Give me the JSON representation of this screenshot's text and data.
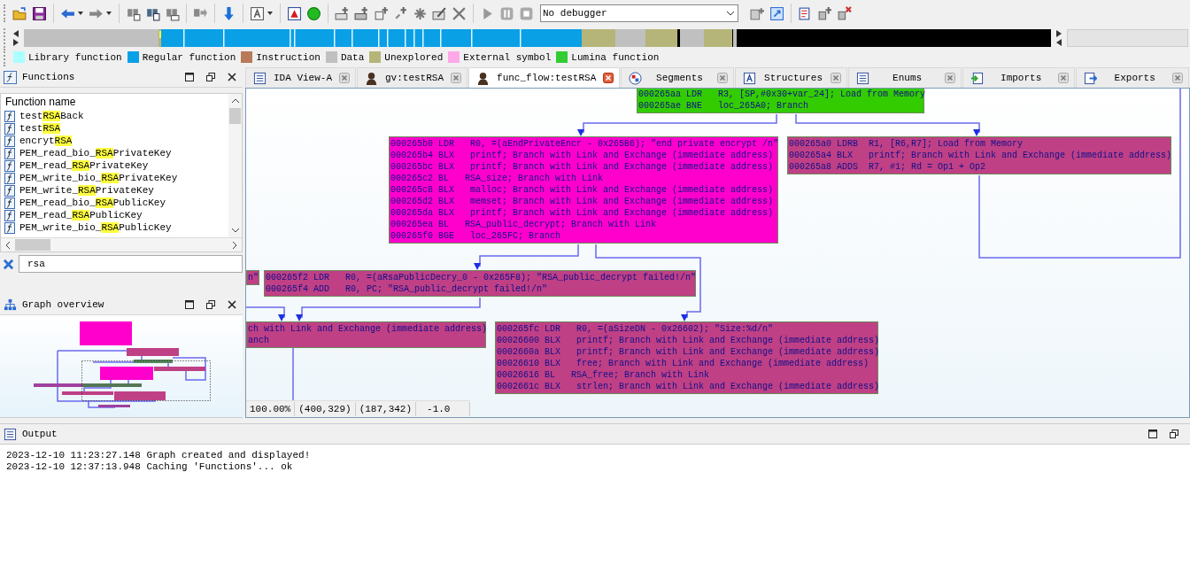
{
  "toolbar": {
    "debugger_select": "No debugger"
  },
  "legend": [
    {
      "label": "Library function",
      "color": "#aaffff"
    },
    {
      "label": "Regular function",
      "color": "#0aa0e6"
    },
    {
      "label": "Instruction",
      "color": "#b87a58"
    },
    {
      "label": "Data",
      "color": "#c0c0c0"
    },
    {
      "label": "Unexplored",
      "color": "#b5b57a"
    },
    {
      "label": "External symbol",
      "color": "#ffa8e8"
    },
    {
      "label": "Lumina function",
      "color": "#33cc33"
    }
  ],
  "functions_panel": {
    "title": "Functions",
    "column": "Function name",
    "items": [
      {
        "prefix": "test",
        "match": "RSA",
        "suffix": "Back"
      },
      {
        "prefix": "test",
        "match": "RSA"
      },
      {
        "prefix": "encryt",
        "match": "RSA"
      },
      {
        "prefix": "PEM_read_bio_",
        "match": "RSA",
        "suffix": "PrivateKey"
      },
      {
        "prefix": "PEM_read_",
        "match": "RSA",
        "suffix": "PrivateKey"
      },
      {
        "prefix": "PEM_write_bio_",
        "match": "RSA",
        "suffix": "PrivateKey"
      },
      {
        "prefix": "PEM_write_",
        "match": "RSA",
        "suffix": "PrivateKey"
      },
      {
        "prefix": "PEM_read_bio_",
        "match": "RSA",
        "suffix": "PublicKey"
      },
      {
        "prefix": "PEM_read_",
        "match": "RSA",
        "suffix": "PublicKey"
      },
      {
        "prefix": "PEM_write_bio_",
        "match": "RSA",
        "suffix": "PublicKey"
      }
    ],
    "filter": "rsa"
  },
  "overview_panel": {
    "title": "Graph overview"
  },
  "tabs": [
    {
      "label": "IDA View-A",
      "selected": false
    },
    {
      "label": "gv:testRSA",
      "selected": false
    },
    {
      "label": "func_flow:testRSA",
      "selected": true
    },
    {
      "label": "Segments",
      "selected": false
    },
    {
      "label": "Structures",
      "selected": false
    },
    {
      "label": "Enums",
      "selected": false
    },
    {
      "label": "Imports",
      "selected": false
    },
    {
      "label": "Exports",
      "selected": false
    }
  ],
  "graph": {
    "blocks": [
      {
        "color": "#33cc00",
        "lines": [
          "000265aa LDR   R3, [SP,#0x30+var_24]; Load from Memory",
          "000265ae BNE   loc_265A0; Branch"
        ]
      },
      {
        "color": "#ff00cc",
        "lines": [
          "000265b0 LDR   R0, =(aEndPrivateEncr - 0x265B6); \"end private encrypt /n\"",
          "000265b4 BLX   printf; Branch with Link and Exchange (immediate address)",
          "000265bc BLX   printf; Branch with Link and Exchange (immediate address)",
          "000265c2 BL   RSA_size; Branch with Link",
          "000265c8 BLX   malloc; Branch with Link and Exchange (immediate address)",
          "000265d2 BLX   memset; Branch with Link and Exchange (immediate address)",
          "000265da BLX   printf; Branch with Link and Exchange (immediate address)",
          "000265ea BL   RSA_public_decrypt; Branch with Link",
          "000265f0 BGE   loc_265FC; Branch"
        ]
      },
      {
        "color": "#bf4085",
        "lines": [
          "000265a0 LDRB  R1, [R6,R7]; Load from Memory",
          "000265a4 BLX   printf; Branch with Link and Exchange (immediate address)",
          "000265a8 ADDS  R7, #1; Rd = Op1 + Op2"
        ]
      },
      {
        "color": "#bf4085",
        "lines": [
          "n\""
        ]
      },
      {
        "color": "#bf4085",
        "lines": [
          "000265f2 LDR   R0, =(aRsaPublicDecry_0 - 0x265F8); \"RSA_public_decrypt failed!/n\"",
          "000265f4 ADD   R0, PC; \"RSA_public_decrypt failed!/n\""
        ]
      },
      {
        "color": "#bf4085",
        "lines": [
          "ch with Link and Exchange (immediate address)",
          "anch"
        ]
      },
      {
        "color": "#bf4085",
        "lines": [
          "000265fc LDR   R0, =(aSizeDN - 0x26602); \"Size:%d/n\"",
          "00026600 BLX   printf; Branch with Link and Exchange (immediate address)",
          "0002660a BLX   printf; Branch with Link and Exchange (immediate address)",
          "00026610 BLX   free; Branch with Link and Exchange (immediate address)",
          "00026616 BL   RSA_free; Branch with Link",
          "0002661c BLX   strlen; Branch with Link and Exchange (immediate address)"
        ]
      }
    ],
    "status": [
      "100.00%",
      "(400,329)",
      "(187,342)",
      "-1.0"
    ]
  },
  "output": {
    "title": "Output",
    "lines": [
      "2023-12-10 11:23:27.148 Graph created and displayed!",
      "2023-12-10 12:37:13.948 Caching 'Functions'... ok"
    ]
  }
}
